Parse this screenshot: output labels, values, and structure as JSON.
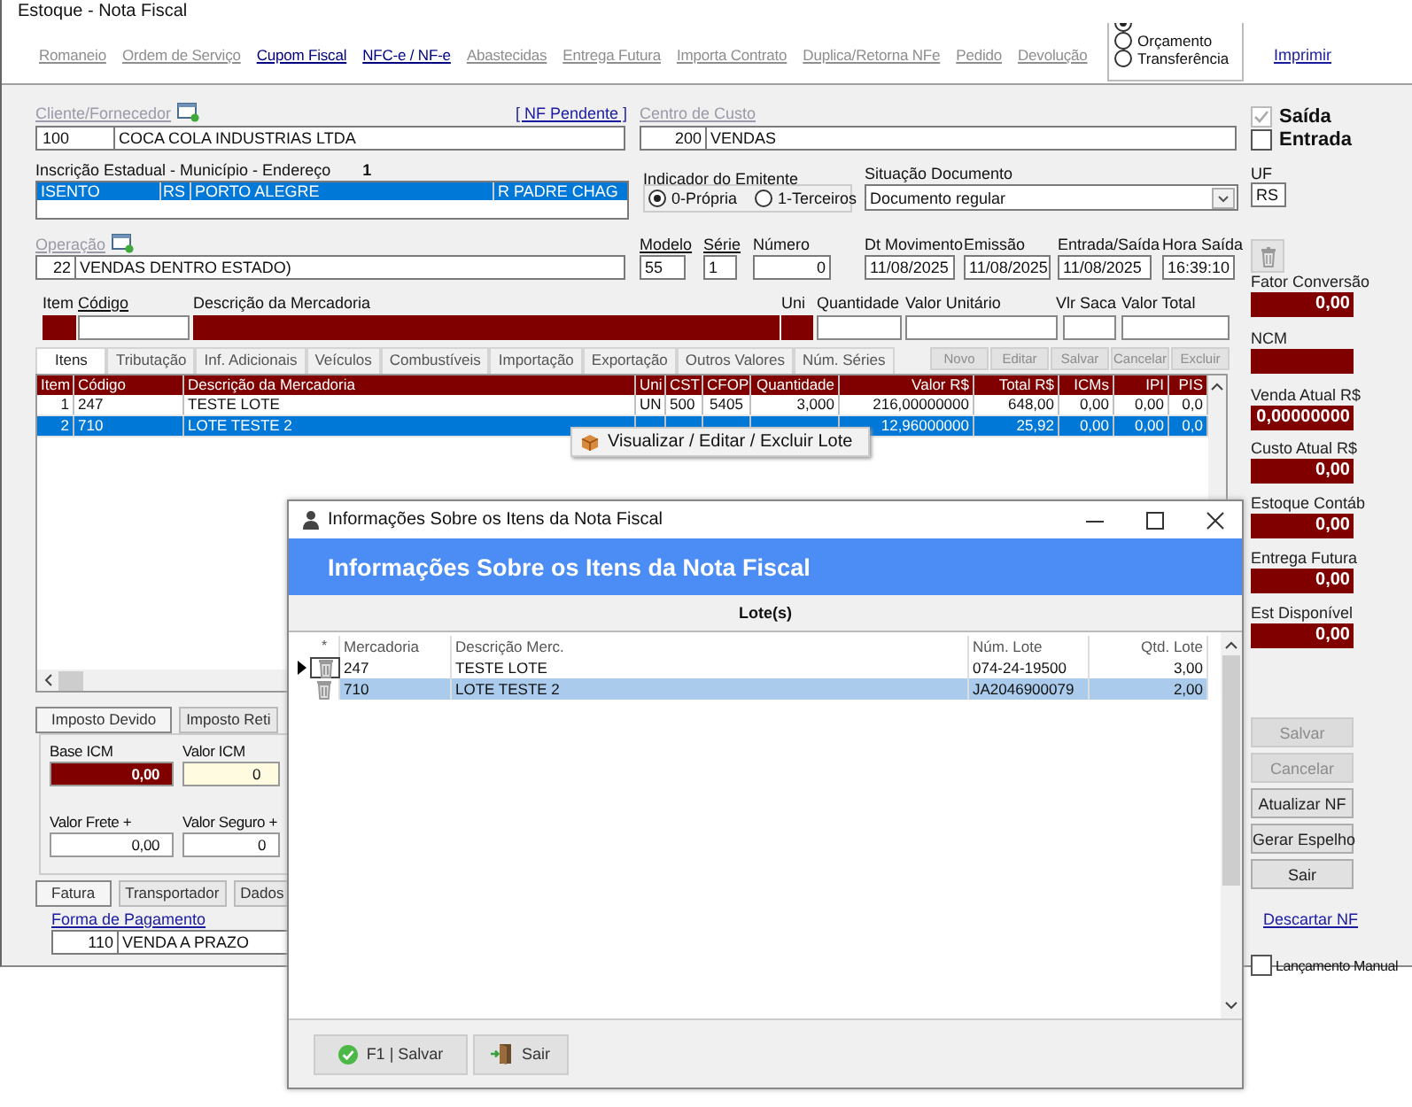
{
  "window": {
    "title": "Estoque - Nota Fiscal"
  },
  "top_links": [
    {
      "label": "Romaneio",
      "disabled": true
    },
    {
      "label": "Ordem de Serviço",
      "disabled": true
    },
    {
      "label": "Cupom Fiscal",
      "disabled": false
    },
    {
      "label": "NFC-e / NF-e",
      "disabled": false
    },
    {
      "label": "Abastecidas",
      "disabled": true
    },
    {
      "label": "Entrega Futura",
      "disabled": true
    },
    {
      "label": "Importa Contrato",
      "disabled": true
    },
    {
      "label": "Duplica/Retorna NFe",
      "disabled": true
    },
    {
      "label": "Pedido",
      "disabled": true
    },
    {
      "label": "Devolução",
      "disabled": true
    }
  ],
  "order_type": [
    {
      "selected": true
    },
    {
      "label": "Orçamento",
      "selected": false
    },
    {
      "label": "Transferência",
      "selected": false
    }
  ],
  "print_link": "Imprimir",
  "client": {
    "label": "Cliente/Fornecedor",
    "pending_link": "[ NF Pendente ]",
    "code": "100",
    "name": "COCA COLA INDUSTRIAS LTDA"
  },
  "cost_center": {
    "label": "Centro de Custo",
    "code": "200",
    "name": "VENDAS"
  },
  "direction": [
    {
      "label": "Saída",
      "checked": true,
      "disabled": true
    },
    {
      "label": "Entrada",
      "checked": false,
      "disabled": false
    }
  ],
  "registration": {
    "label": "Inscrição Estadual - Município - Endereço",
    "count": "1",
    "rows": [
      {
        "cells": [
          "ISENTO",
          "RS",
          "PORTO ALEGRE",
          "R PADRE CHAG"
        ],
        "selected": true
      }
    ]
  },
  "issuer": {
    "label": "Indicador do Emitente",
    "options": [
      {
        "label": "0-Própria",
        "selected": true
      },
      {
        "label": "1-Terceiros",
        "selected": false
      }
    ]
  },
  "document_status": {
    "label": "Situação Documento",
    "value": "Documento regular"
  },
  "uf": {
    "label": "UF",
    "value": "RS"
  },
  "operation": {
    "label": "Operação",
    "code": "22",
    "name": "VENDAS DENTRO ESTADO)"
  },
  "doc_fields": [
    {
      "label": "Modelo",
      "value": "55"
    },
    {
      "label": "Série",
      "value": "1"
    },
    {
      "label": "Número",
      "value": "0"
    },
    {
      "label": "Dt Movimento",
      "value": "11/08/2025"
    },
    {
      "label": "Emissão",
      "value": "11/08/2025"
    },
    {
      "label": "Entrada/Saída",
      "value": "11/08/2025"
    },
    {
      "label": "Hora Saída",
      "value": "16:39:10"
    }
  ],
  "item_entry": [
    {
      "label": "Item",
      "kind": "locked"
    },
    {
      "label": "Código",
      "kind": "input"
    },
    {
      "label": "Descrição da Mercadoria",
      "kind": "locked"
    },
    {
      "label": "Uni",
      "kind": "locked"
    },
    {
      "label": "Quantidade",
      "kind": "input"
    },
    {
      "label": "Valor Unitário",
      "kind": "input"
    },
    {
      "label": "Vlr Saca",
      "kind": "input"
    },
    {
      "label": "Valor Total",
      "kind": "input"
    }
  ],
  "item_tabs": [
    {
      "label": "Itens",
      "selected": true
    },
    {
      "label": "Tributação",
      "selected": false
    },
    {
      "label": "Inf. Adicionais",
      "selected": false
    },
    {
      "label": "Veículos",
      "selected": false
    },
    {
      "label": "Combustíveis",
      "selected": false
    },
    {
      "label": "Importação",
      "selected": false
    },
    {
      "label": "Exportação",
      "selected": false
    },
    {
      "label": "Outros Valores",
      "selected": false
    },
    {
      "label": "Núm. Séries",
      "selected": false
    }
  ],
  "item_actions": [
    {
      "label": "Novo",
      "disabled": true
    },
    {
      "label": "Editar",
      "disabled": true
    },
    {
      "label": "Salvar",
      "disabled": true
    },
    {
      "label": "Cancelar",
      "disabled": true
    },
    {
      "label": "Excluir",
      "disabled": true
    }
  ],
  "items_table": {
    "columns": [
      "Item",
      "Código",
      "Descrição da Mercadoria",
      "Uni",
      "CST",
      "CFOP",
      "Quantidade",
      "Valor R$",
      "Total R$",
      "ICMs",
      "IPI",
      "PIS"
    ],
    "rows": [
      {
        "cells": [
          "1",
          "247",
          "TESTE LOTE",
          "UN",
          "500",
          "5405",
          "3,000",
          "216,00000000",
          "648,00",
          "0,00",
          "0,00",
          "0,0"
        ],
        "selected": false
      },
      {
        "cells": [
          "2",
          "710",
          "LOTE TESTE 2",
          null,
          null,
          null,
          null,
          "12,96000000",
          "25,92",
          "0,00",
          "0,00",
          "0,0"
        ],
        "selected": true
      }
    ]
  },
  "context_menu": {
    "items": [
      "Visualizar / Editar / Excluir Lote"
    ]
  },
  "indicators": [
    {
      "label": "Fator Conversão",
      "value": "0,00"
    },
    {
      "label": "NCM"
    },
    {
      "label": "Venda Atual R$",
      "value": "0,00000000"
    },
    {
      "label": "Custo Atual R$",
      "value": "0,00"
    },
    {
      "label": "Estoque Contáb",
      "value": "0,00"
    },
    {
      "label": "Entrega Futura",
      "value": "0,00"
    },
    {
      "label": "Est Disponível",
      "value": "0,00"
    }
  ],
  "side_buttons": [
    {
      "label": "Salvar",
      "disabled": true
    },
    {
      "label": "Cancelar",
      "disabled": true
    },
    {
      "label": "Atualizar NF",
      "disabled": false
    },
    {
      "label": "Gerar Espelho",
      "disabled": false
    },
    {
      "label": "Sair",
      "disabled": false
    }
  ],
  "discard_link": "Descartar NF",
  "manual_entry": {
    "label": "Lançamento Manual",
    "checked": false
  },
  "tax_tabs": [
    {
      "label": "Imposto Devido",
      "selected": true
    },
    {
      "label": "Imposto Reti",
      "selected": false
    }
  ],
  "tax_fields": [
    {
      "label": "Base ICM",
      "value": "0,00",
      "kind": "locked"
    },
    {
      "label": "Valor ICM",
      "value": "0",
      "kind": "highlight"
    },
    {
      "label": "Valor Frete +",
      "value": "0,00",
      "kind": "plain"
    },
    {
      "label": "Valor Seguro +",
      "value": "0",
      "kind": "plain"
    }
  ],
  "bottom_tabs": [
    {
      "label": "Fatura",
      "selected": true
    },
    {
      "label": "Transportador",
      "selected": false
    },
    {
      "label": "Dados",
      "selected": false
    }
  ],
  "payment": {
    "label": "Forma de Pagamento",
    "code": "110",
    "name": "VENDA A PRAZO"
  },
  "dialog": {
    "title": "Informações Sobre os Itens da Nota Fiscal",
    "header": "Informações Sobre os Itens da Nota Fiscal",
    "section": "Lote(s)",
    "marker_header": "*",
    "columns": [
      "Mercadoria",
      "Descrição Merc.",
      "Núm. Lote",
      "Qtd. Lote"
    ],
    "rows": [
      {
        "cells": [
          "247",
          "TESTE LOTE",
          "074-24-19500",
          "3,00"
        ],
        "current": true,
        "selected": false
      },
      {
        "cells": [
          "710",
          "LOTE TESTE 2",
          "JA2046900079",
          "2,00"
        ],
        "current": false,
        "selected": true
      }
    ],
    "buttons": [
      {
        "label": "F1 | Salvar",
        "kind": "confirm"
      },
      {
        "label": "Sair",
        "kind": "exit"
      }
    ]
  }
}
